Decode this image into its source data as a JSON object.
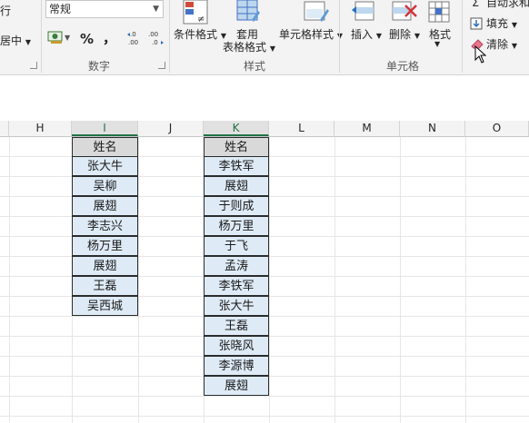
{
  "ribbon": {
    "align_top_partial": "行",
    "merge_partial": "居中",
    "number_format_value": "常规",
    "percent_symbol": "%",
    "comma_symbol": "，",
    "dec_increase": "←.0\n.00",
    "dec_decrease": ".00\n→.0",
    "group_number": "数字",
    "conditional_format": "条件格式",
    "format_as_table_l1": "套用",
    "format_as_table_l2": "表格格式",
    "cell_styles": "单元格样式",
    "group_styles": "样式",
    "insert": "插入",
    "delete": "删除",
    "format": "格式",
    "group_cells": "单元格",
    "autosum_partial": "自动求和",
    "fill": "填充",
    "clear": "清除"
  },
  "columns": [
    "H",
    "I",
    "J",
    "K",
    "L",
    "M",
    "N",
    "O"
  ],
  "list_i": {
    "header": "姓名",
    "items": [
      "张大牛",
      "吴柳",
      "展翅",
      "李志兴",
      "杨万里",
      "展翅",
      "王磊",
      "吴西城"
    ]
  },
  "list_k": {
    "header": "姓名",
    "items": [
      "李铁军",
      "展翅",
      "于则成",
      "杨万里",
      "于飞",
      "孟涛",
      "李铁军",
      "张大牛",
      "王磊",
      "张晓风",
      "李源博",
      "展翅"
    ]
  }
}
